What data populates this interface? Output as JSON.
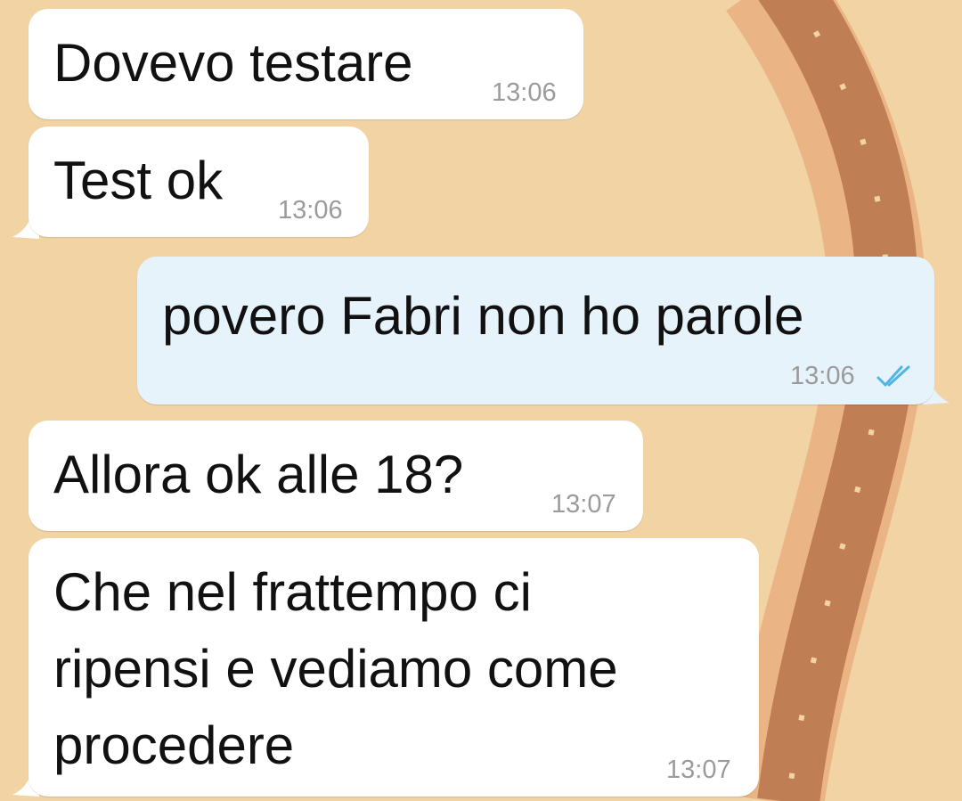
{
  "chat": {
    "messages": [
      {
        "text": "Dovevo testare",
        "time": "13:06",
        "direction": "incoming"
      },
      {
        "text": "Test ok",
        "time": "13:06",
        "direction": "incoming"
      },
      {
        "text": "povero Fabri non ho parole",
        "time": "13:06",
        "direction": "outgoing",
        "status": "read-double-check-icon"
      },
      {
        "text": "Allora ok alle 18?",
        "time": "13:07",
        "direction": "incoming"
      },
      {
        "text": "Che nel frattempo ci\nripensi e vediamo come\nprocedere",
        "time": "13:07",
        "direction": "incoming"
      }
    ]
  },
  "colors": {
    "background": "#f2d3a4",
    "incoming_bubble": "#ffffff",
    "outgoing_bubble": "#e7f3fb",
    "read_tick": "#4fb5e6",
    "film_strip": "#b5714a"
  }
}
